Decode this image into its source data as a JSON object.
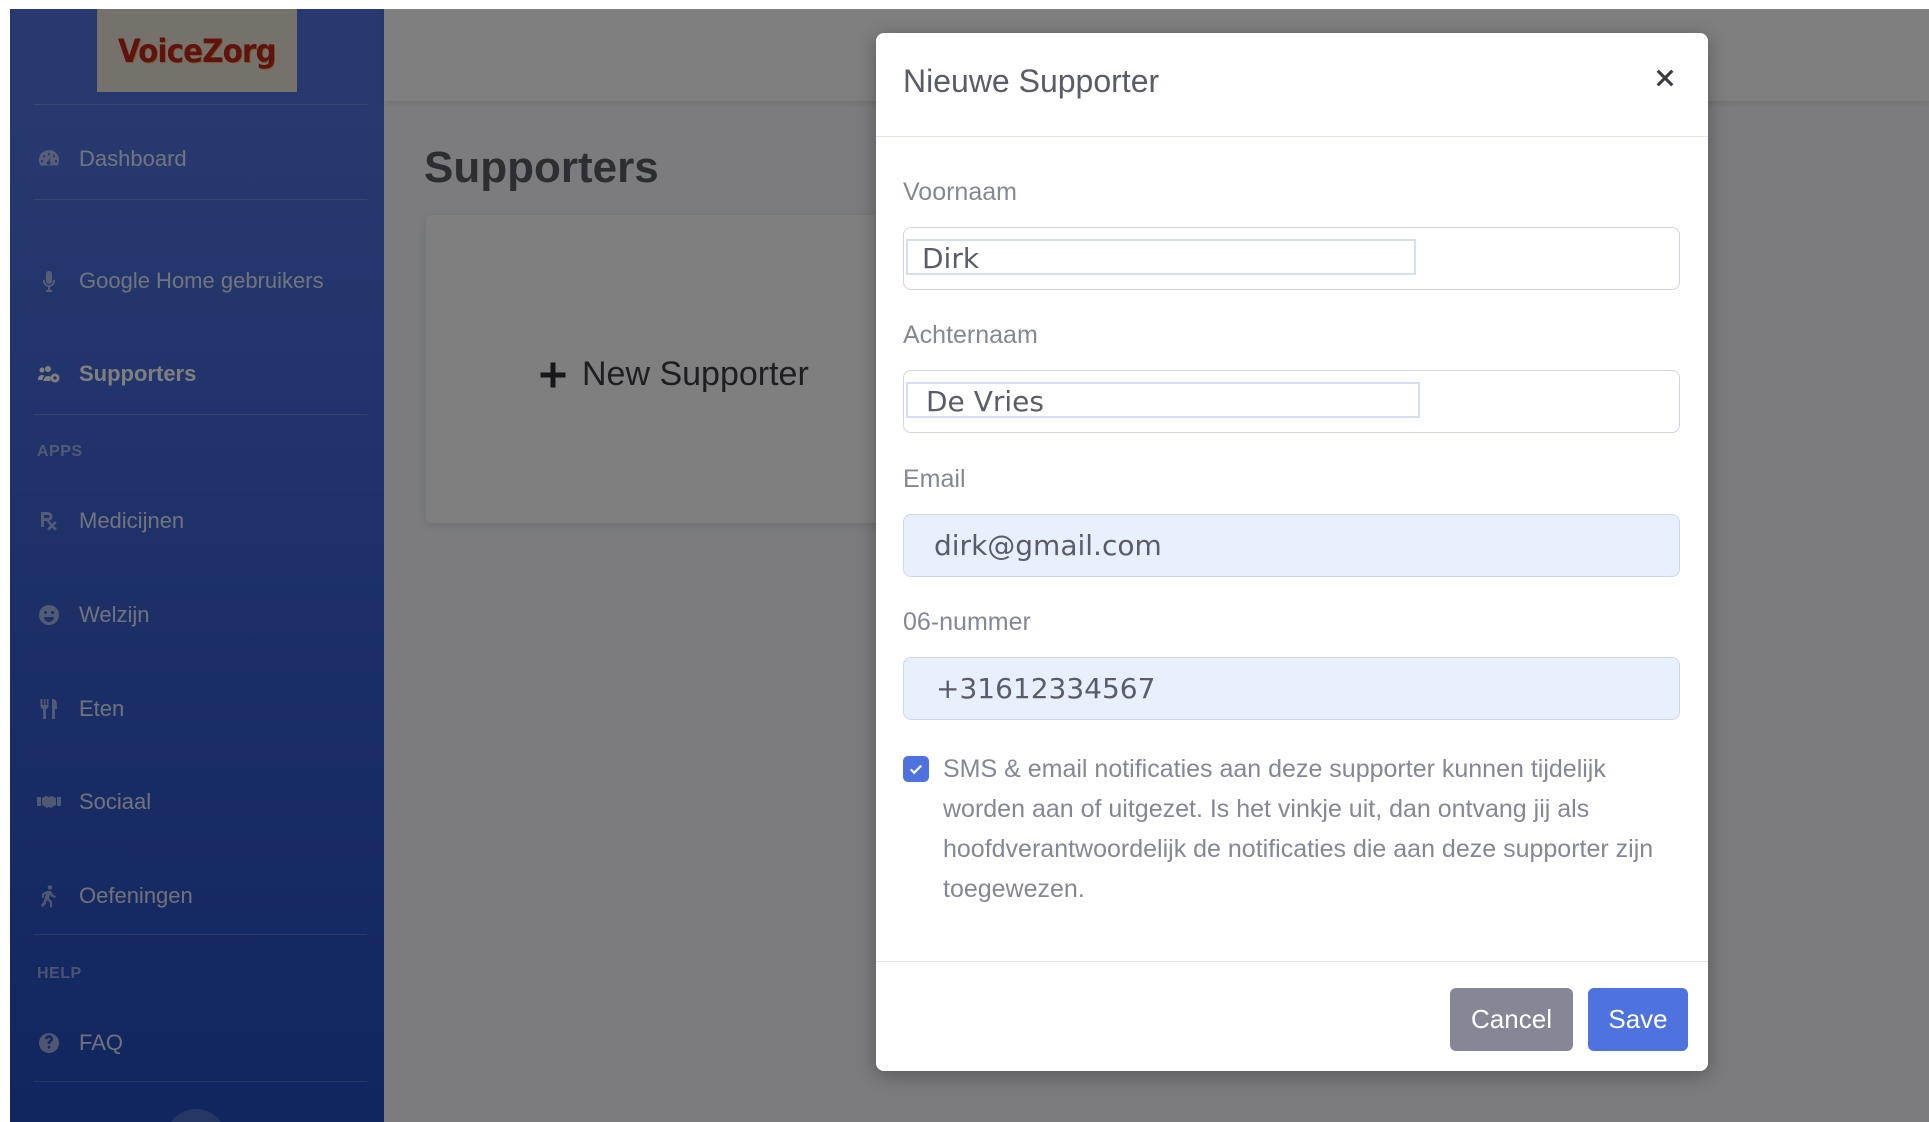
{
  "brand": {
    "name": "VoiceZorg"
  },
  "sidebar": {
    "items": [
      {
        "label": "Dashboard",
        "icon": "tachometer-icon"
      },
      {
        "label": "Google Home gebruikers",
        "icon": "microphone-icon"
      },
      {
        "label": "Supporters",
        "icon": "users-cog-icon",
        "active": true
      }
    ],
    "apps_heading": "APPS",
    "apps": [
      {
        "label": "Medicijnen",
        "icon": "prescription-icon"
      },
      {
        "label": "Welzijn",
        "icon": "smile-icon"
      },
      {
        "label": "Eten",
        "icon": "utensils-icon"
      },
      {
        "label": "Sociaal",
        "icon": "handshake-icon"
      },
      {
        "label": "Oefeningen",
        "icon": "walking-icon"
      }
    ],
    "help_heading": "HELP",
    "help": [
      {
        "label": "FAQ",
        "icon": "question-circle-icon"
      }
    ]
  },
  "main": {
    "title": "Supporters",
    "new_supporter_label": "New Supporter"
  },
  "modal": {
    "title": "Nieuwe Supporter",
    "fields": {
      "voornaam": {
        "label": "Voornaam",
        "value": "Dirk"
      },
      "achternaam": {
        "label": "Achternaam",
        "value": "De Vries"
      },
      "email": {
        "label": "Email",
        "value": "dirk@gmail.com"
      },
      "phone": {
        "label": "06-nummer",
        "value": "+31612334567"
      }
    },
    "notifications": {
      "checked": true,
      "text": "SMS & email notificaties aan deze supporter kunnen tijdelijk worden aan of uitgezet. Is het vinkje uit, dan ontvang jij als hoofdverantwoordelijk de notificaties die aan deze supporter zijn toegewezen."
    },
    "cancel_label": "Cancel",
    "save_label": "Save"
  },
  "colors": {
    "sidebar_primary": "#4e73df",
    "sidebar_dark": "#224abe",
    "save_button": "#4e73df",
    "cancel_button": "#858796",
    "prefilled_input": "#e8f0fe"
  }
}
